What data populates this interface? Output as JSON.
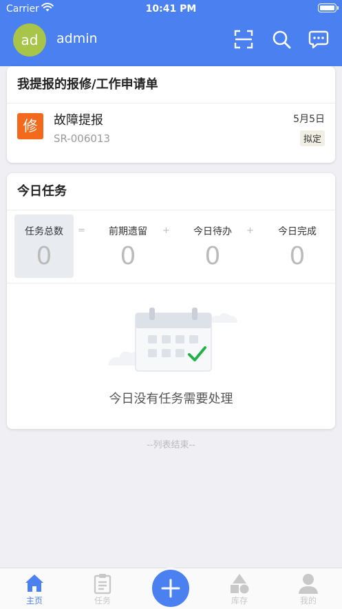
{
  "status_bar": {
    "carrier": "Carrier",
    "time": "10:41 PM"
  },
  "header": {
    "avatar_text": "ad",
    "username": "admin"
  },
  "repair_card": {
    "title": "我提报的报修/工作申请单",
    "item": {
      "badge": "修",
      "name": "故障提报",
      "code": "SR-006013",
      "date": "5月5日",
      "status": "拟定"
    }
  },
  "task_card": {
    "title": "今日任务",
    "stats": [
      {
        "label": "任务总数",
        "value": "0"
      },
      {
        "label": "前期遗留",
        "value": "0"
      },
      {
        "label": "今日待办",
        "value": "0"
      },
      {
        "label": "今日完成",
        "value": "0"
      }
    ],
    "operators": [
      "=",
      "+",
      "+"
    ],
    "empty_text": "今日没有任务需要处理"
  },
  "list_end": "--列表结束--",
  "tabbar": {
    "items": [
      {
        "label": "主页",
        "icon": "home-icon",
        "active": true
      },
      {
        "label": "任务",
        "icon": "clipboard-icon",
        "active": false
      },
      {
        "label": "库存",
        "icon": "shapes-icon",
        "active": false
      },
      {
        "label": "我的",
        "icon": "person-icon",
        "active": false
      }
    ],
    "add_icon": "plus-icon"
  },
  "colors": {
    "primary": "#4a80f0",
    "repair_badge": "#f36a1d",
    "avatar": "#a8c54a",
    "check": "#22b04b"
  }
}
